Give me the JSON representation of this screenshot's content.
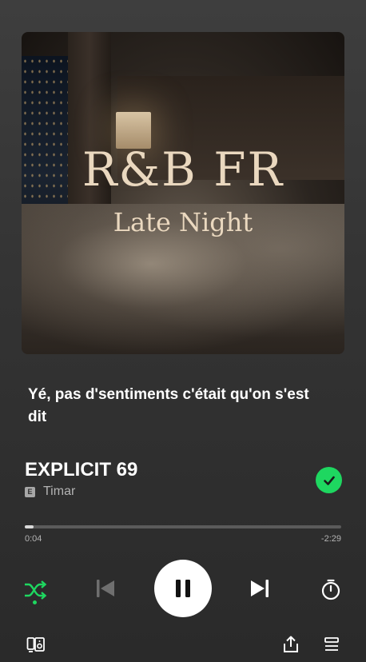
{
  "album_art": {
    "title_line1": "R&B FR",
    "title_line2": "Late Night"
  },
  "lyric": "Yé, pas d'sentiments c'était qu'on s'est dit",
  "track": {
    "title": "EXPLICIT 69",
    "explicit_badge": "E",
    "artist": "Timar",
    "liked": true
  },
  "playback": {
    "elapsed": "0:04",
    "remaining": "-2:29",
    "progress": 0.027,
    "state": "playing",
    "shuffle": true
  },
  "colors": {
    "accent": "#1ed760",
    "background": "#333333",
    "secondary_text": "#b3b3b3"
  },
  "icons": {
    "shuffle": "shuffle-icon",
    "previous": "skip-previous-icon",
    "pause": "pause-icon",
    "next": "skip-next-icon",
    "timer": "sleep-timer-icon",
    "devices": "connect-device-icon",
    "share": "share-icon",
    "queue": "queue-icon",
    "liked": "check-icon"
  }
}
